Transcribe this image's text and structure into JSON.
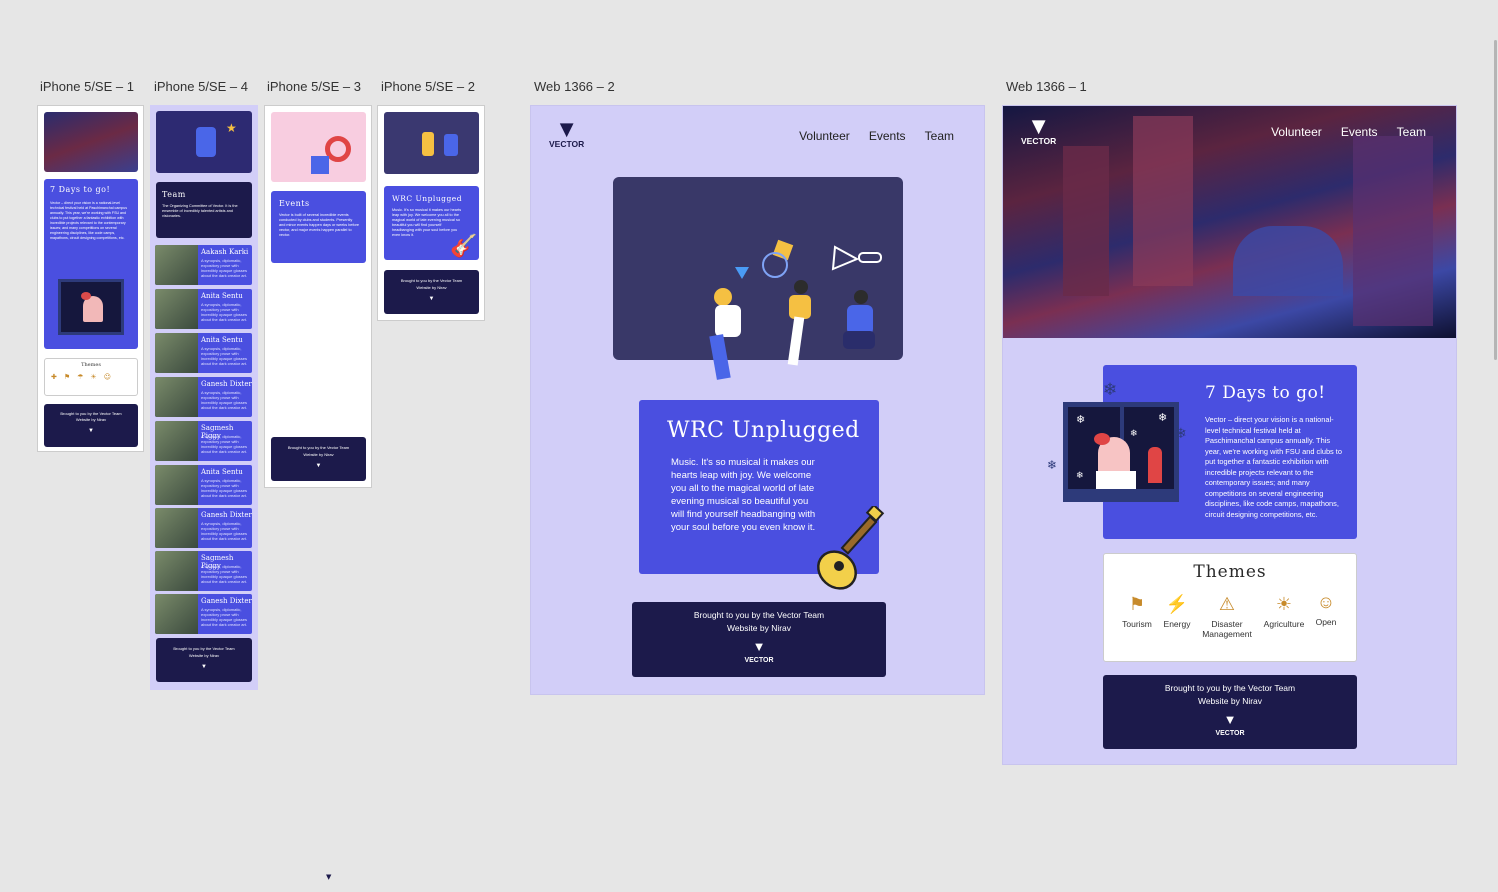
{
  "artboards": [
    {
      "label": "iPhone 5/SE – 1"
    },
    {
      "label": "iPhone 5/SE – 4"
    },
    {
      "label": "iPhone 5/SE – 3"
    },
    {
      "label": "iPhone 5/SE – 2"
    },
    {
      "label": "Web 1366 – 2"
    },
    {
      "label": "Web 1366 – 1"
    }
  ],
  "brand": {
    "name": "VECTOR"
  },
  "nav": {
    "volunteer": "Volunteer",
    "events": "Events",
    "team": "Team"
  },
  "days": {
    "title": "7 Days to go!",
    "body": "Vector – direct your vision is a national-level technical festival held at Paschimanchal campus annually. This year, we're working with FSU and clubs to put together a fantastic exhibition with incredible projects relevant to the contemporary issues; and many competitions on several engineering disciplines, like code camps, mapathons, circuit designing competitions, etc."
  },
  "themes": {
    "title": "Themes",
    "items": [
      {
        "label": "Tourism",
        "icon": "signpost-icon"
      },
      {
        "label": "Energy",
        "icon": "energy-icon"
      },
      {
        "label": "Disaster Management",
        "icon": "disaster-icon"
      },
      {
        "label": "Agriculture",
        "icon": "agriculture-icon"
      },
      {
        "label": "Open",
        "icon": "open-icon"
      }
    ]
  },
  "footer": {
    "line1": "Brought to you by the Vector Team",
    "line2": "Website by Nirav"
  },
  "wrc": {
    "title": "WRC Unplugged",
    "body": "Music. It's so musical it makes our hearts leap with joy. We welcome you all to the magical world of late evening musical so beautiful you will find yourself headbanging with your soul before you even know it."
  },
  "team": {
    "title": "Team",
    "body": "The Organizing Committee of Vector. It is the ensemble of incredibly talented artists and visionaries.",
    "members": [
      {
        "name": "Aakash Karki"
      },
      {
        "name": "Anita Sentu"
      },
      {
        "name": "Anita Sentu"
      },
      {
        "name": "Ganesh Dixter"
      },
      {
        "name": "Sagmesh Piggy"
      },
      {
        "name": "Anita Sentu"
      },
      {
        "name": "Ganesh Dixter"
      },
      {
        "name": "Sagmesh Piggy"
      },
      {
        "name": "Ganesh Dixter"
      }
    ],
    "member_blurb": "A synopsis, diplomatic, expository prose with incredibly opaque glosses about the dark creator art."
  },
  "events": {
    "title": "Events",
    "body": "Vector is built of several incredible events conducted by clubs and students. Presently and minor events happen days or weeks before vector, and major events happen parallel to vector."
  },
  "colors": {
    "lavender": "#d2cef8",
    "blue": "#4a4fe0",
    "navy": "#1c1a4b",
    "canvas": "#e6e6e6"
  }
}
